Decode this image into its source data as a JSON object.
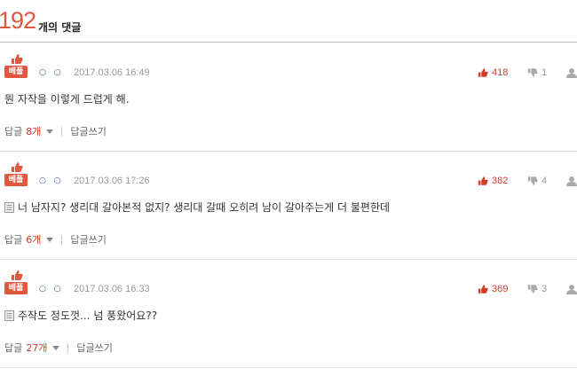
{
  "header": {
    "count": "192",
    "count_label": "개의 댓글"
  },
  "common": {
    "best_label": "베플",
    "circles": "○ ○",
    "reply_label": "답글",
    "write_label": "답글쓰기"
  },
  "comments": [
    {
      "date": "2017.03.06 16:49",
      "up": "418",
      "down": "1",
      "text": "뭔 자작을 이렇게 드럽게 해.",
      "replies": "8개",
      "has_doc_icon": false
    },
    {
      "date": "2017.03.06 17:26",
      "up": "382",
      "down": "4",
      "text": "너 남자지? 생리대 갈아본적 없지? 생리대 갈때 오히려 남이 갈아주는게 더 불편한데",
      "replies": "6개",
      "has_doc_icon": true
    },
    {
      "date": "2017.03.06 16:33",
      "up": "369",
      "down": "3",
      "text": "주작도 정도껏... 넘 풍왔어요??",
      "replies": "27개",
      "has_doc_icon": true
    }
  ],
  "colors": {
    "accent": "#e2583e",
    "up": "#d23a2a",
    "circles": "#2c4f9e"
  }
}
